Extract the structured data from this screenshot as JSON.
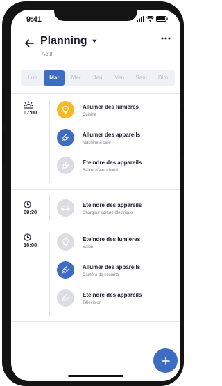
{
  "status_bar": {
    "time": "9:41"
  },
  "header": {
    "title": "Planning",
    "subtitle": "Actif"
  },
  "days": [
    "Lun",
    "Mar",
    "Mer",
    "Jeu",
    "Ven",
    "Sam",
    "Dim"
  ],
  "selected_day": "Mar",
  "colors": {
    "accent": "#3d6cc2",
    "light": "#f7b82a",
    "inactive": "#dcdde2"
  },
  "schedule": [
    {
      "time": "07:00",
      "time_icon": "sunrise-icon",
      "items": [
        {
          "title": "Allumer des lumières",
          "subtitle": "Cuisine",
          "icon": "lightbulb-icon",
          "state": "yellow"
        },
        {
          "title": "Allumer des appareils",
          "subtitle": "Machine à café",
          "icon": "plug-icon",
          "state": "blue"
        },
        {
          "title": "Eteindre des appareils",
          "subtitle": "Ballon d'eau chaud",
          "icon": "plug-icon",
          "state": "grey"
        }
      ]
    },
    {
      "time": "09:30",
      "time_icon": "clock-icon",
      "items": [
        {
          "title": "Eteindre des appareils",
          "subtitle": "Chargeur voiture électrique",
          "icon": "car-icon",
          "state": "grey"
        }
      ]
    },
    {
      "time": "10:00",
      "time_icon": "clock-icon",
      "items": [
        {
          "title": "Eteindre des lumières",
          "subtitle": "Salon",
          "icon": "lightbulb-icon",
          "state": "grey"
        },
        {
          "title": "Allumer des appareils",
          "subtitle": "Caméra de securité",
          "icon": "plug-icon",
          "state": "blue"
        },
        {
          "title": "Eteindre des appareils",
          "subtitle": "Télévision",
          "icon": "plug-icon",
          "state": "grey"
        }
      ]
    }
  ]
}
